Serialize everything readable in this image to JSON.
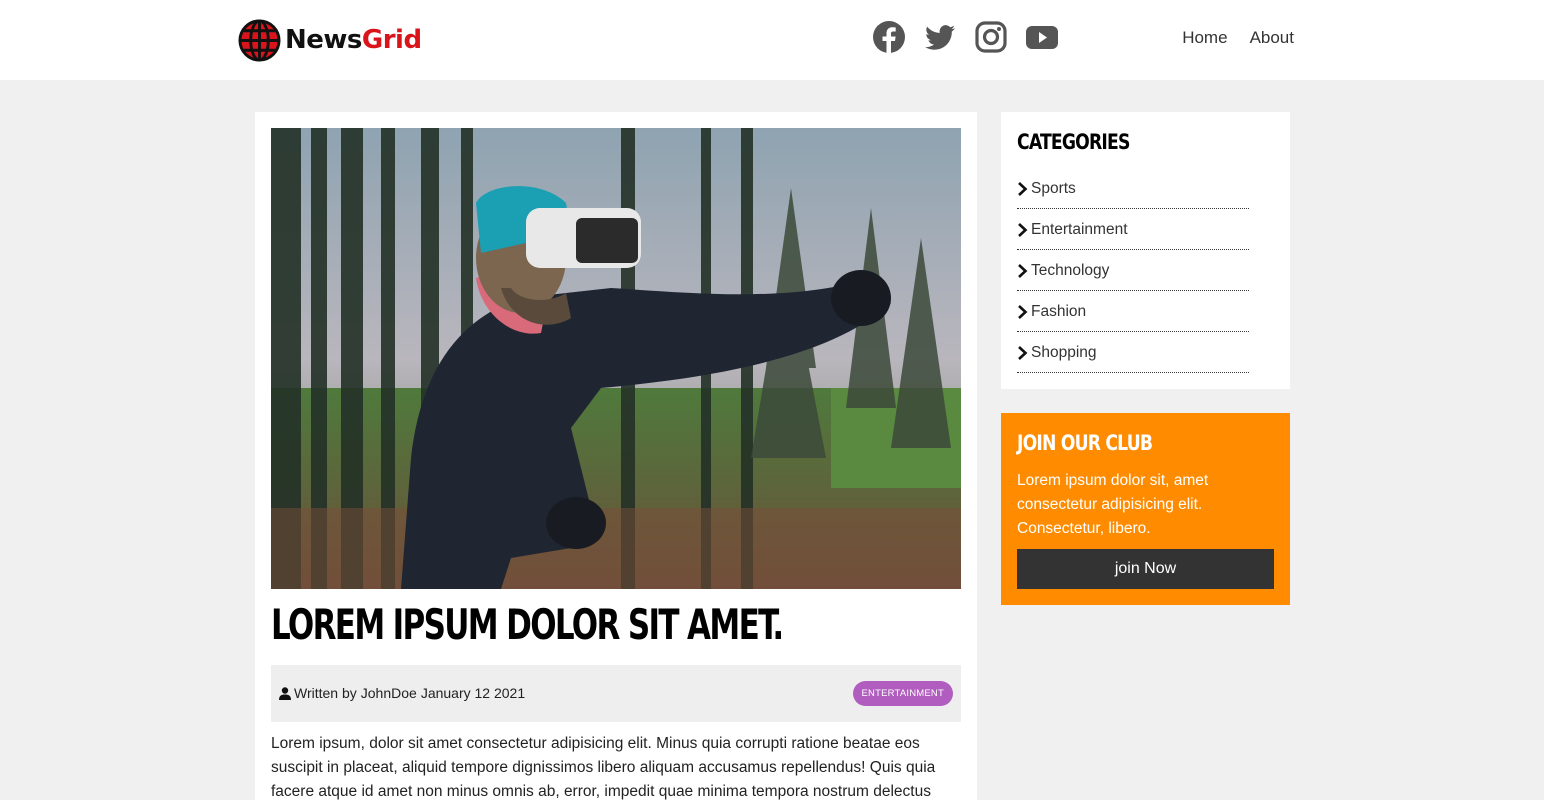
{
  "brand": {
    "news": "News",
    "grid": "Grid",
    "accent_color": "#d9141b"
  },
  "social": [
    {
      "icon": "facebook-icon"
    },
    {
      "icon": "twitter-icon"
    },
    {
      "icon": "instagram-icon"
    },
    {
      "icon": "youtube-icon"
    }
  ],
  "nav": {
    "home": "Home",
    "about": "About"
  },
  "article": {
    "title": "LOREM IPSUM DOLOR SIT AMET.",
    "author_prefix": "Written by",
    "author": "JohnDoe",
    "date": "January 12 2021",
    "badge": "ENTERTAINMENT",
    "badge_color": "#b15dbf",
    "body": "Lorem ipsum, dolor sit amet consectetur adipisicing elit. Minus quia corrupti ratione beatae eos suscipit in placeat, aliquid tempore dignissimos libero aliquam accusamus repellendus! Quis quia facere atque id amet non minus omnis ab, error, impedit quae minima tempora nostrum delectus"
  },
  "categories": {
    "title": "CATEGORIES",
    "items": [
      {
        "label": "Sports"
      },
      {
        "label": "Entertainment"
      },
      {
        "label": "Technology"
      },
      {
        "label": "Fashion"
      },
      {
        "label": "Shopping"
      }
    ]
  },
  "club": {
    "title": "JOIN OUR CLUB",
    "text": "Lorem ipsum dolor sit, amet consectetur adipisicing elit. Consectetur, libero.",
    "button": "join Now",
    "bg_color": "#ff8c00"
  }
}
